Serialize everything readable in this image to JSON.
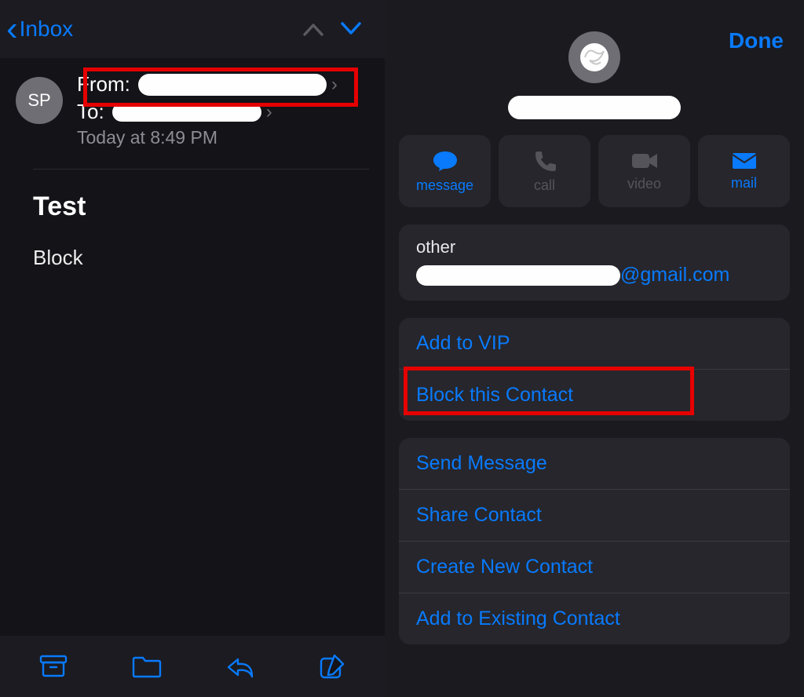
{
  "left": {
    "back_label": "Inbox",
    "avatar_initials": "SP",
    "from_label": "From:",
    "to_label": "To:",
    "timestamp": "Today at 8:49 PM",
    "subject": "Test",
    "body": "Block"
  },
  "right": {
    "done_label": "Done",
    "actions": {
      "message": "message",
      "call": "call",
      "video": "video",
      "mail": "mail"
    },
    "email_section_label": "other",
    "email_suffix": "@gmail.com",
    "vip_group": {
      "add_vip": "Add to VIP",
      "block": "Block this Contact"
    },
    "actions_group": {
      "send_message": "Send Message",
      "share_contact": "Share Contact",
      "create_contact": "Create New Contact",
      "add_existing": "Add to Existing Contact"
    }
  }
}
